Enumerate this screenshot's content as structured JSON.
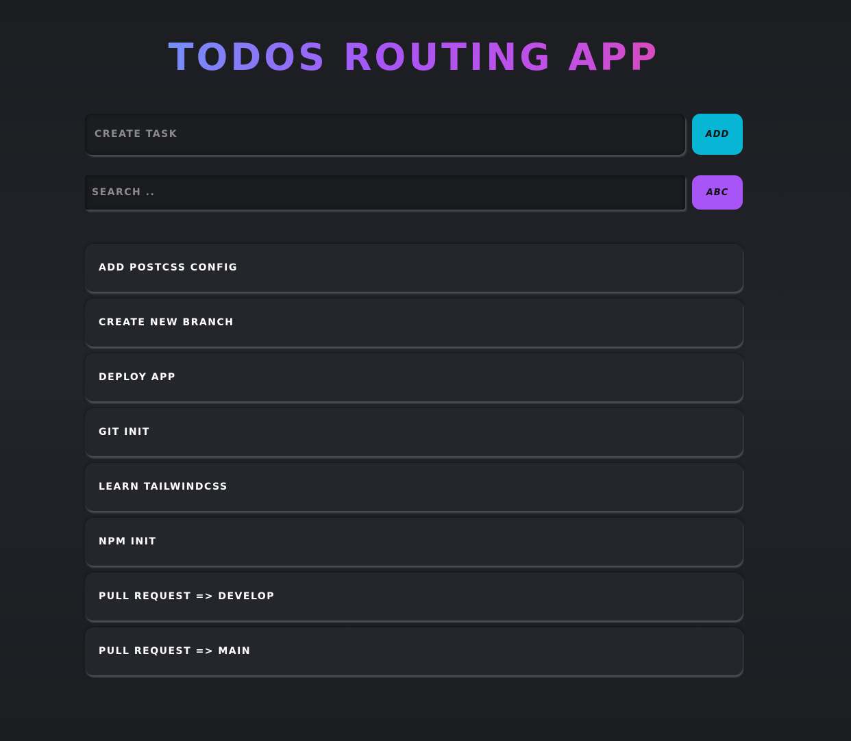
{
  "header": {
    "title": "Todos Routing App"
  },
  "create": {
    "placeholder": "Create Task",
    "button_label": "Add"
  },
  "search": {
    "placeholder": "Search ..",
    "button_label": "ABC"
  },
  "tasks": [
    {
      "label": "Add postcss config"
    },
    {
      "label": "Create new branch"
    },
    {
      "label": "Deploy app"
    },
    {
      "label": "git init"
    },
    {
      "label": "learn tailwindcss"
    },
    {
      "label": "npm init"
    },
    {
      "label": "pull request => develop"
    },
    {
      "label": "pull request => main"
    }
  ],
  "colors": {
    "background": "#1f2025",
    "add_button": "#06b6d4",
    "sort_button": "#a855f7",
    "title_gradient": [
      "#60a5fa",
      "#a855f7",
      "#ec4899"
    ]
  }
}
